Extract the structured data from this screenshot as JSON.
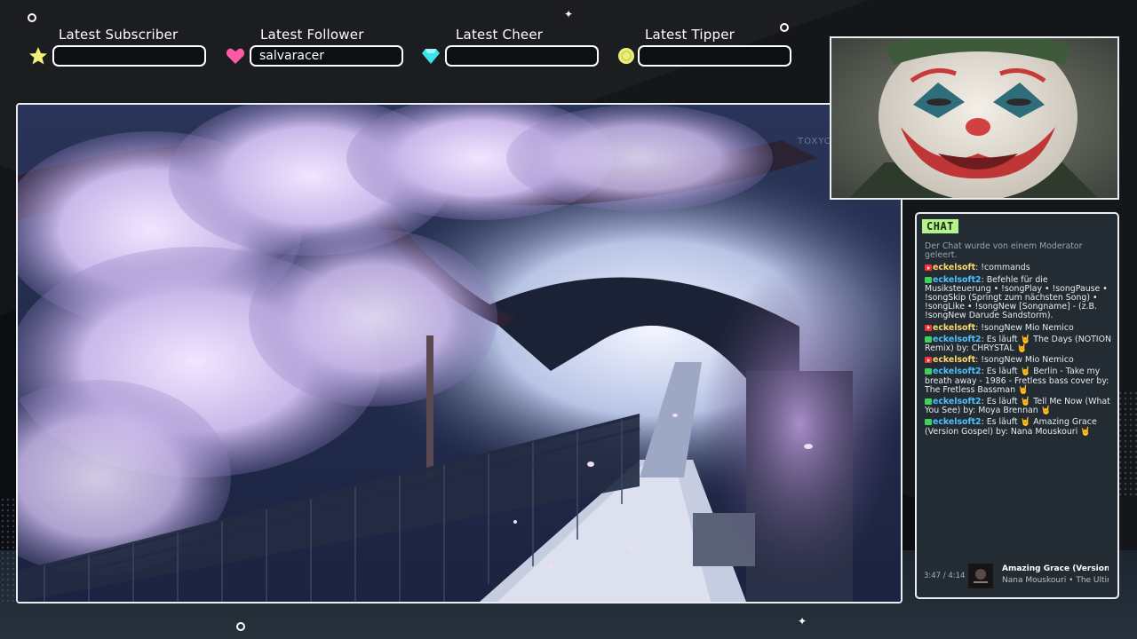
{
  "alerts": [
    {
      "label": "Latest Subscriber",
      "value": "",
      "icon": "star-icon",
      "color": "#f3f07a"
    },
    {
      "label": "Latest Follower",
      "value": "salvaracer",
      "icon": "heart-icon",
      "color": "#ff5aa8"
    },
    {
      "label": "Latest Cheer",
      "value": "",
      "icon": "gem-icon",
      "color": "#3be3e8"
    },
    {
      "label": "Latest Tipper",
      "value": "",
      "icon": "coin-icon",
      "color": "#e8f07a"
    }
  ],
  "scene": {
    "watermark": "TOXYC"
  },
  "chat": {
    "title": "CHAT",
    "notice": "Der Chat wurde von einem Moderator geleert.",
    "messages": [
      {
        "badge": "yt",
        "user": "eckelsoft",
        "text": ": !commands"
      },
      {
        "badge": "mod",
        "user": "eckelsoft2",
        "text": ": Befehle für die Musiksteuerung • !songPlay • !songPause • !songSkip (Springt zum nächsten Song) • !songLike • !songNew [Songname] - (z.B. !songNew Darude Sandstorm)."
      },
      {
        "badge": "yt",
        "user": "eckelsoft",
        "text": ": !songNew Mio Nemico"
      },
      {
        "badge": "mod",
        "user": "eckelsoft2",
        "text": ": Es läuft 🤘 The Days (NOTION Remix) by: CHRYSTAL 🤘"
      },
      {
        "badge": "yt",
        "user": "eckelsoft",
        "text": ": !songNew Mio Nemico"
      },
      {
        "badge": "mod",
        "user": "eckelsoft2",
        "text": ": Es läuft 🤘 Berlin - Take my breath away - 1986 - Fretless bass cover by: The Fretless Bassman 🤘"
      },
      {
        "badge": "mod",
        "user": "eckelsoft2",
        "text": ": Es läuft 🤘 Tell Me Now (What You See) by: Moya Brennan 🤘"
      },
      {
        "badge": "mod",
        "user": "eckelsoft2",
        "text": ": Es läuft 🤘 Amazing Grace (Version Gospel) by: Nana Mouskouri 🤘"
      }
    ]
  },
  "now_playing": {
    "time": "3:47 / 4:14",
    "title": "Amazing Grace (Version ...",
    "artist": "Nana Mouskouri • The Ultin"
  }
}
